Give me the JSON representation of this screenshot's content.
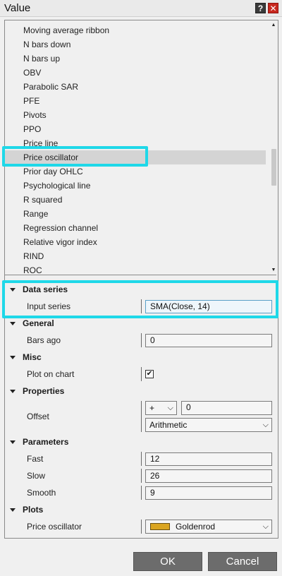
{
  "window": {
    "title": "Value",
    "help_label": "?",
    "close_label": "✕"
  },
  "list": {
    "items": [
      "Moving average ribbon",
      "N bars down",
      "N bars up",
      "OBV",
      "Parabolic SAR",
      "PFE",
      "Pivots",
      "PPO",
      "Price line",
      "Price oscillator",
      "Prior day OHLC",
      "Psychological line",
      "R squared",
      "Range",
      "Regression channel",
      "Relative vigor index",
      "RIND",
      "ROC"
    ],
    "selected": "Price oscillator",
    "scroll_up": "▲",
    "scroll_down": "▼"
  },
  "properties": {
    "data_series": {
      "header": "Data series",
      "input_series_label": "Input series",
      "input_series_value": "SMA(Close, 14)"
    },
    "general": {
      "header": "General",
      "bars_ago_label": "Bars ago",
      "bars_ago_value": "0"
    },
    "misc": {
      "header": "Misc",
      "plot_on_chart_label": "Plot on chart",
      "plot_on_chart_check": "✔"
    },
    "props": {
      "header": "Properties",
      "offset_label": "Offset",
      "offset_sign": "+",
      "offset_value": "0",
      "offset_type": "Arithmetic"
    },
    "parameters": {
      "header": "Parameters",
      "fast_label": "Fast",
      "fast_value": "12",
      "slow_label": "Slow",
      "slow_value": "26",
      "smooth_label": "Smooth",
      "smooth_value": "9"
    },
    "plots": {
      "header": "Plots",
      "price_oscillator_label": "Price oscillator",
      "color_name": "Goldenrod",
      "color_hex": "#DAA520"
    }
  },
  "buttons": {
    "ok": "OK",
    "cancel": "Cancel"
  },
  "colors": {
    "highlight": "#1fd8e8",
    "selected_row": "#d4d4d4",
    "button_bg": "#6c6c6c"
  }
}
